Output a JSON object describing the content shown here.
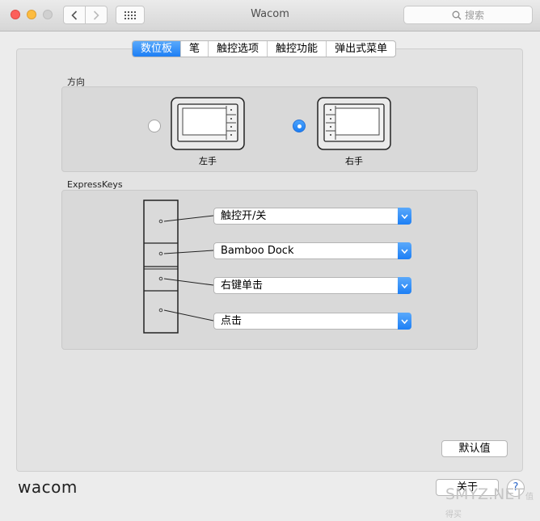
{
  "window": {
    "title": "Wacom"
  },
  "search": {
    "placeholder": "搜索"
  },
  "tabs": [
    {
      "label": "数位板",
      "active": true
    },
    {
      "label": "笔",
      "active": false
    },
    {
      "label": "触控选项",
      "active": false
    },
    {
      "label": "触控功能",
      "active": false
    },
    {
      "label": "弹出式菜单",
      "active": false
    }
  ],
  "orientation": {
    "label": "方向",
    "left_label": "左手",
    "right_label": "右手",
    "selected": "右手"
  },
  "expresskeys": {
    "label": "ExpressKeys",
    "keys": [
      {
        "value": "触控开/关"
      },
      {
        "value": "Bamboo Dock"
      },
      {
        "value": "右键单击"
      },
      {
        "value": "点击"
      }
    ]
  },
  "buttons": {
    "defaults": "默认值",
    "close": "关于",
    "help": "?"
  },
  "brand": {
    "logo_text": "wacom"
  },
  "watermark": {
    "text": "SMYZ.NET",
    "site": "值得买"
  },
  "colors": {
    "accent": "#1d7ff5",
    "accent_light": "#5aa9fb"
  }
}
